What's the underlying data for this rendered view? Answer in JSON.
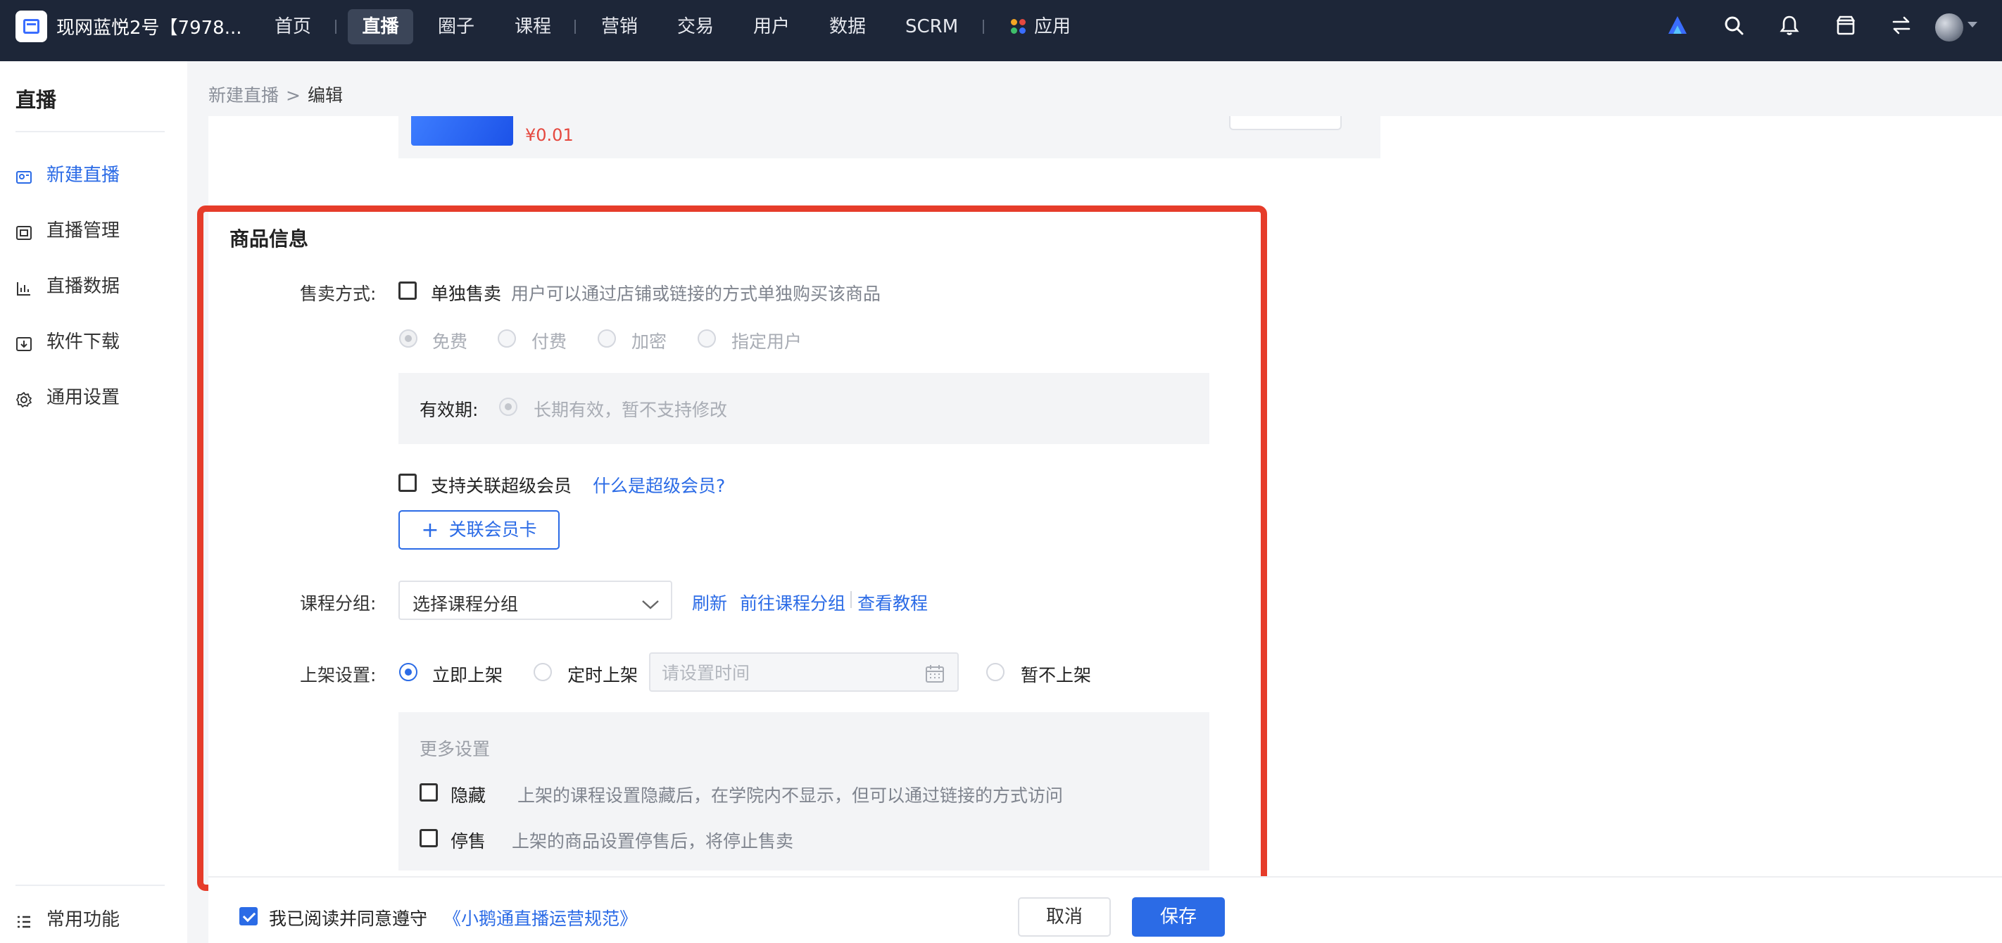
{
  "topbar": {
    "shop_name": "现网蓝悦2号【7978...",
    "nav": [
      {
        "label": "首页"
      },
      {
        "label": "直播"
      },
      {
        "label": "圈子"
      },
      {
        "label": "课程"
      },
      {
        "label": "营销"
      },
      {
        "label": "交易"
      },
      {
        "label": "用户"
      },
      {
        "label": "数据"
      },
      {
        "label": "SCRM"
      },
      {
        "label": "应用"
      }
    ],
    "active_nav": "直播",
    "icons": [
      "brand-logo-icon",
      "search-icon",
      "bell-icon",
      "store-icon",
      "switch-icon",
      "avatar"
    ]
  },
  "sidebar": {
    "title": "直播",
    "items": [
      {
        "label": "新建直播",
        "icon": "live-add-icon",
        "active": true
      },
      {
        "label": "直播管理",
        "icon": "live-manage-icon"
      },
      {
        "label": "直播数据",
        "icon": "chart-icon"
      },
      {
        "label": "软件下载",
        "icon": "download-icon"
      },
      {
        "label": "通用设置",
        "icon": "gear-icon"
      }
    ],
    "bottom_item": {
      "label": "常用功能",
      "icon": "list-icon"
    }
  },
  "breadcrumb": {
    "prev": "新建直播",
    "sep": ">",
    "current": "编辑"
  },
  "goods": {
    "price": "¥0.01"
  },
  "form": {
    "section_title": "商品信息",
    "sale_method": {
      "label": "售卖方式:",
      "option": "单独售卖",
      "desc": "用户可以通过店铺或链接的方式单独购买该商品",
      "price_types": [
        "免费",
        "付费",
        "加密",
        "指定用户"
      ],
      "selected_price_type": "免费"
    },
    "validity": {
      "label": "有效期:",
      "value": "长期有效，暂不支持修改"
    },
    "super_member": {
      "option": "支持关联超级会员",
      "help_link": "什么是超级会员?",
      "add_button": "关联会员卡"
    },
    "course_group": {
      "label": "课程分组:",
      "select_value": "选择课程分组",
      "links": [
        "刷新",
        "前往课程分组",
        "查看教程"
      ]
    },
    "listing": {
      "label": "上架设置:",
      "options": [
        "立即上架",
        "定时上架",
        "暂不上架"
      ],
      "selected": "立即上架",
      "time_placeholder": "请设置时间"
    },
    "more_settings": {
      "title": "更多设置",
      "hide": {
        "label": "隐藏",
        "desc": "上架的课程设置隐藏后，在学院内不显示，但可以通过链接的方式访问"
      },
      "stop_sale": {
        "label": "停售",
        "desc": "上架的商品设置停售后，将停止售卖"
      }
    }
  },
  "footer": {
    "agree_text": "我已阅读并同意遵守",
    "agree_link": "《小鹅通直播运营规范》",
    "agree_checked": true,
    "cancel_label": "取消",
    "save_label": "保存"
  },
  "colors": {
    "topbar_bg": "#1d2638",
    "accent": "#2b6be6",
    "highlight_border": "#e63c2a",
    "price": "#e5483f"
  }
}
